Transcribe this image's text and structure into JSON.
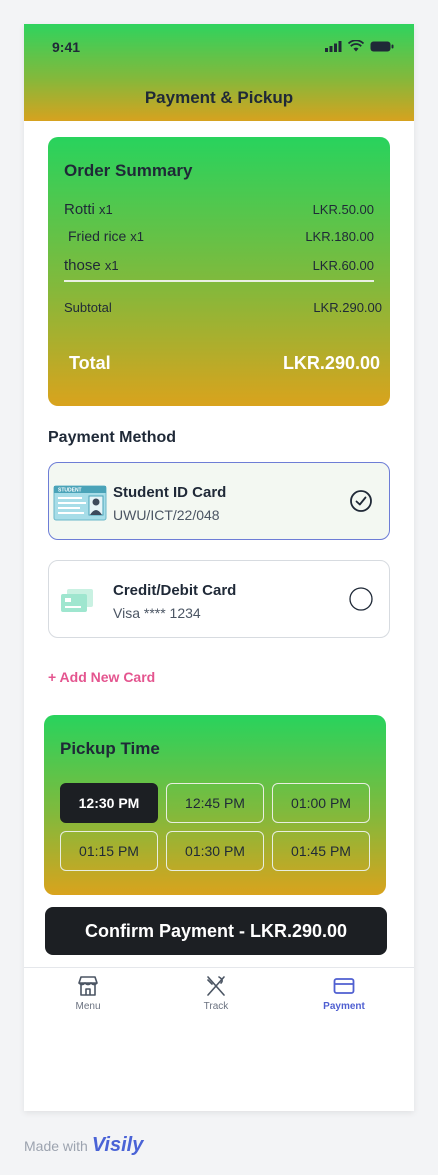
{
  "status_bar": {
    "time": "9:41"
  },
  "header": {
    "title": "Payment & Pickup"
  },
  "order_summary": {
    "title": "Order Summary",
    "items": [
      {
        "name": "Rotti",
        "qty": "x1",
        "price": "LKR.50.00"
      },
      {
        "name": "Fried rice",
        "qty": "x1",
        "price": "LKR.180.00"
      },
      {
        "name": "those",
        "qty": "x1",
        "price": "LKR.60.00"
      }
    ],
    "subtotal_label": "Subtotal",
    "subtotal_value": "LKR.290.00",
    "total_label": "Total",
    "total_value": "LKR.290.00"
  },
  "payment": {
    "section_title": "Payment Method",
    "methods": [
      {
        "name": "Student ID Card",
        "detail": "UWU/ICT/22/048",
        "selected": true,
        "card_text": "STUDENT"
      },
      {
        "name": "Credit/Debit Card",
        "detail": "Visa **** 1234",
        "selected": false
      }
    ],
    "add_card_label": "+ Add New Card"
  },
  "pickup": {
    "title": "Pickup Time",
    "slots": [
      "12:30 PM",
      "12:45 PM",
      "01:00 PM",
      "01:15 PM",
      "01:30 PM",
      "01:45 PM"
    ],
    "selected": "12:30 PM"
  },
  "confirm_button": {
    "label": "Confirm Payment - LKR.290.00"
  },
  "tab_bar": {
    "tabs": [
      {
        "label": "Menu",
        "icon": "store-icon",
        "active": false
      },
      {
        "label": "Track",
        "icon": "utensils-icon",
        "active": false
      },
      {
        "label": "Payment",
        "icon": "card-icon",
        "active": true
      }
    ]
  },
  "footer": {
    "made_with": "Made with",
    "brand": "Visily"
  },
  "colors": {
    "accent": "#4f5fd1",
    "gradient_top": "#28d35d",
    "gradient_bottom": "#d9a31d",
    "link": "#e4558f",
    "dark_button": "#1c1f23"
  }
}
